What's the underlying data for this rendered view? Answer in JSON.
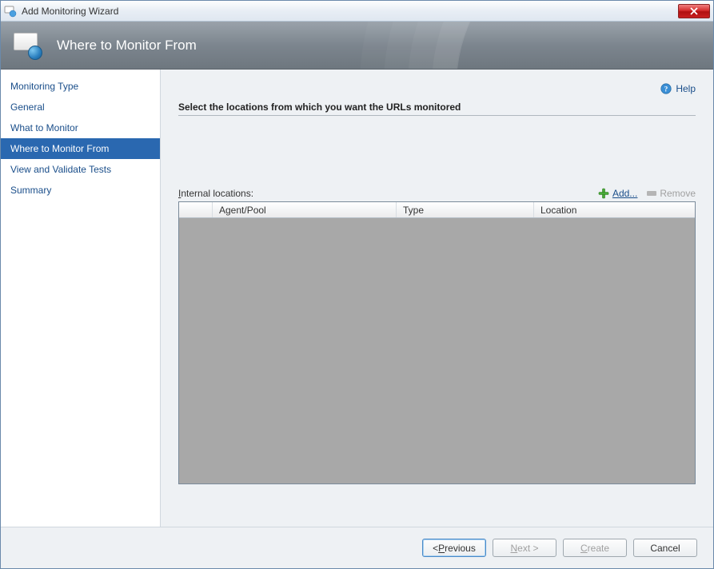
{
  "window": {
    "title": "Add Monitoring Wizard"
  },
  "header": {
    "title": "Where to Monitor From"
  },
  "sidebar": {
    "items": [
      {
        "label": "Monitoring Type",
        "selected": false
      },
      {
        "label": "General",
        "selected": false
      },
      {
        "label": "What to Monitor",
        "selected": false
      },
      {
        "label": "Where to Monitor From",
        "selected": true
      },
      {
        "label": "View and Validate Tests",
        "selected": false
      },
      {
        "label": "Summary",
        "selected": false
      }
    ]
  },
  "content": {
    "help_label": "Help",
    "instruction": "Select the locations from which you want the URLs monitored",
    "locations_label_prefix": "I",
    "locations_label_rest": "nternal locations:",
    "add_label_prefix": "A",
    "add_label_rest": "dd...",
    "remove_label": "Remove",
    "columns": {
      "agent": "Agent/Pool",
      "type": "Type",
      "location": "Location"
    }
  },
  "footer": {
    "previous_prefix": "< ",
    "previous_ul": "P",
    "previous_rest": "revious",
    "next_ul": "N",
    "next_rest": "ext >",
    "create_ul": "C",
    "create_rest": "reate",
    "cancel": "Cancel"
  }
}
